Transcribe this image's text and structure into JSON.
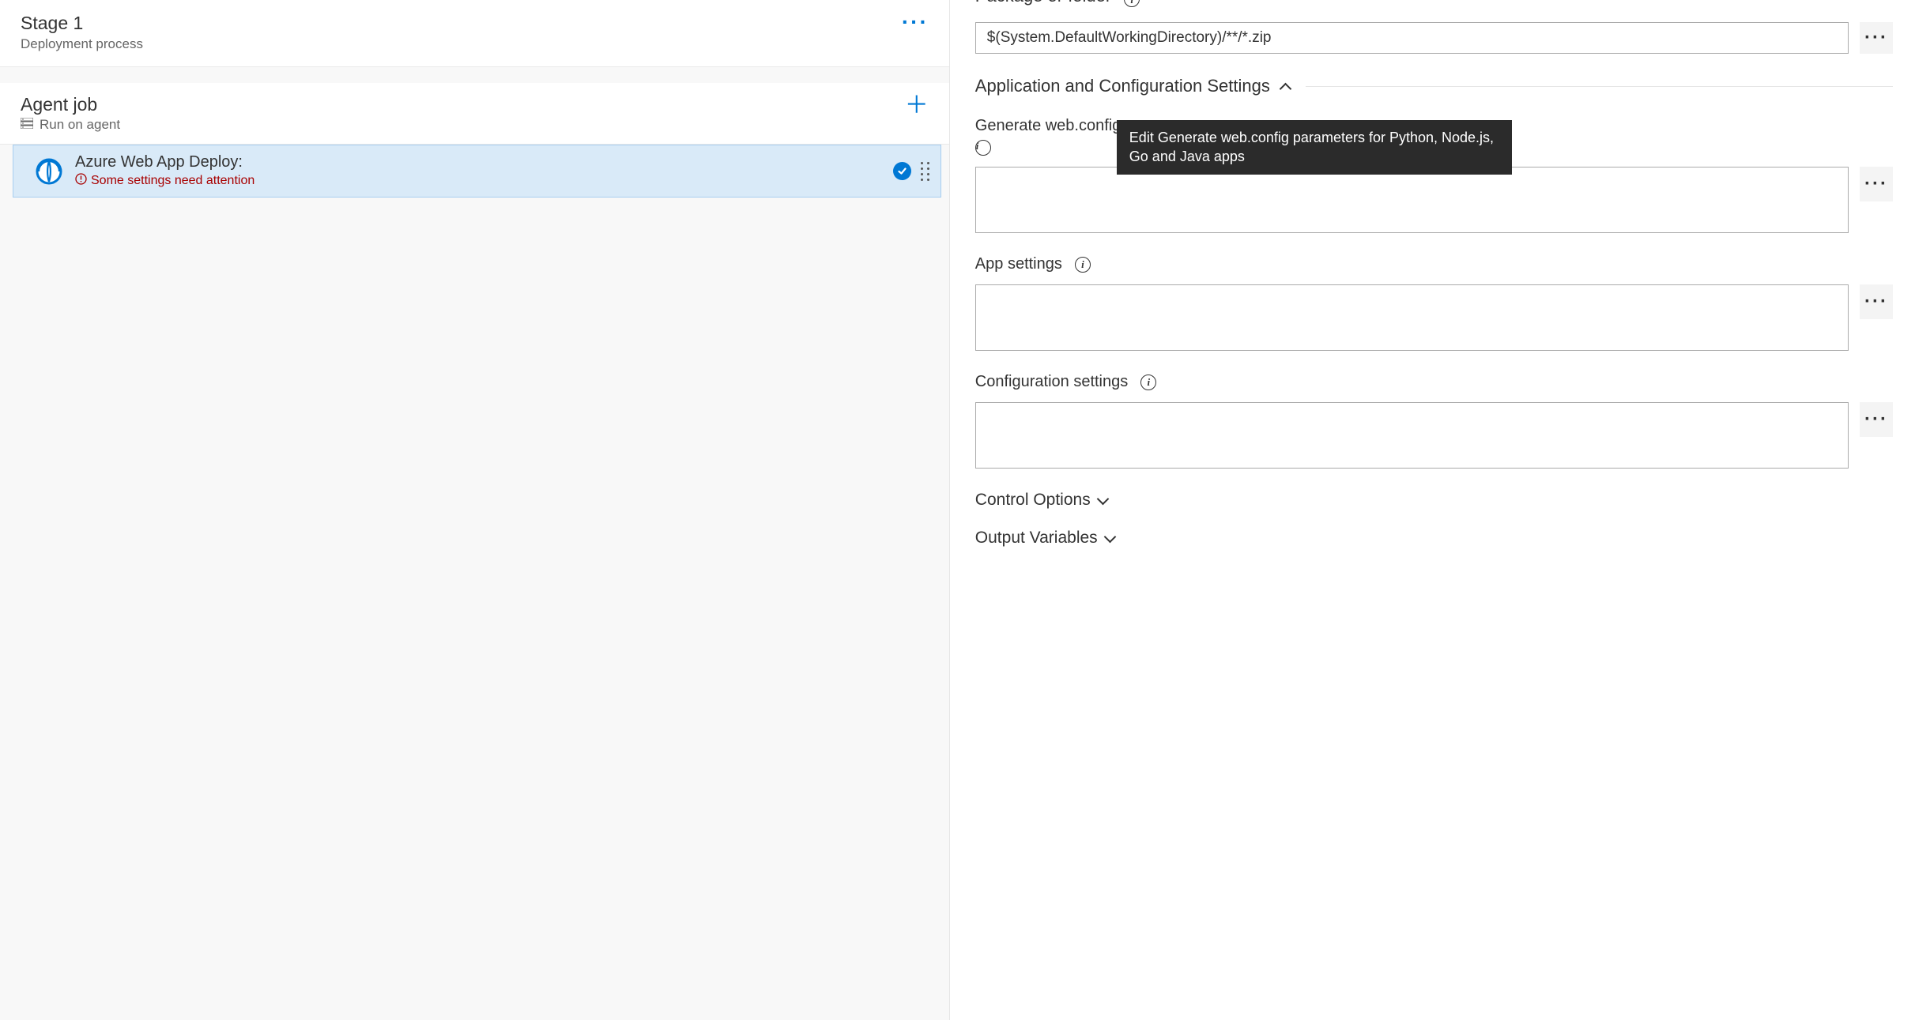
{
  "left": {
    "stage_title": "Stage 1",
    "stage_subtitle": "Deployment process",
    "job_title": "Agent job",
    "job_subtitle": "Run on agent",
    "task_title": "Azure Web App Deploy:",
    "task_warning": "Some settings need attention"
  },
  "right": {
    "package_label": "Package or folder",
    "package_value": "$(System.DefaultWorkingDirectory)/**/*.zip",
    "section_app_config": "Application and Configuration Settings",
    "gen_webconfig_label_visible": "Generate web.config pa",
    "app_settings_label": "App settings",
    "config_settings_label": "Configuration settings",
    "control_options": "Control Options",
    "output_variables": "Output Variables",
    "tooltip": "Edit Generate web.config parameters for Python, Node.js, Go and Java apps"
  }
}
